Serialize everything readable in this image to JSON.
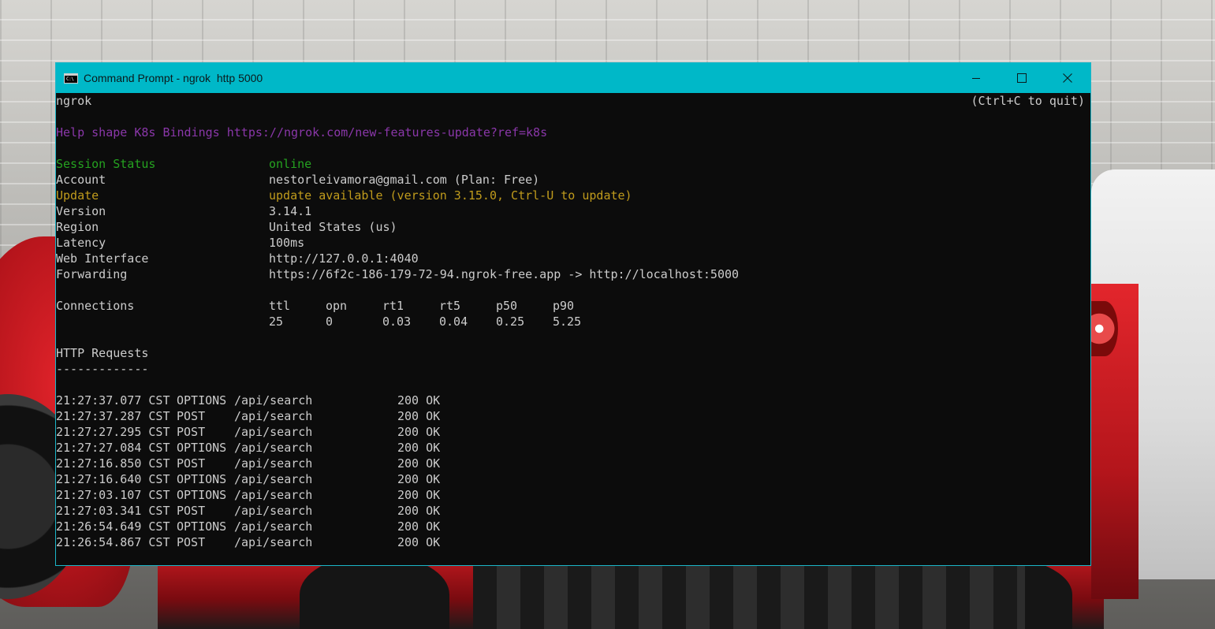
{
  "window": {
    "title": "Command Prompt - ngrok  http 5000"
  },
  "console": {
    "app_name": "ngrok",
    "quit_hint": "(Ctrl+C to quit)",
    "help_line": "Help shape K8s Bindings https://ngrok.com/new-features-update?ref=k8s",
    "status_rows": [
      {
        "label": "Session Status",
        "value": "online",
        "color": "green"
      },
      {
        "label": "Account",
        "value": "nestorleivamora@gmail.com (Plan: Free)",
        "color": "default"
      },
      {
        "label": "Update",
        "value": "update available (version 3.15.0, Ctrl-U to update)",
        "color": "yellow"
      },
      {
        "label": "Version",
        "value": "3.14.1",
        "color": "default"
      },
      {
        "label": "Region",
        "value": "United States (us)",
        "color": "default"
      },
      {
        "label": "Latency",
        "value": "100ms",
        "color": "default"
      },
      {
        "label": "Web Interface",
        "value": "http://127.0.0.1:4040",
        "color": "default"
      },
      {
        "label": "Forwarding",
        "value": "https://6f2c-186-179-72-94.ngrok-free.app -> http://localhost:5000",
        "color": "default"
      }
    ],
    "connections": {
      "label": "Connections",
      "headers": [
        "ttl",
        "opn",
        "rt1",
        "rt5",
        "p50",
        "p90"
      ],
      "values": [
        "25",
        "0",
        "0.03",
        "0.04",
        "0.25",
        "5.25"
      ]
    },
    "http_requests": {
      "title": "HTTP Requests",
      "underline": "-------------",
      "rows": [
        {
          "time": "21:27:37.077 CST",
          "method": "OPTIONS",
          "path": "/api/search",
          "status": "200 OK"
        },
        {
          "time": "21:27:37.287 CST",
          "method": "POST",
          "path": "/api/search",
          "status": "200 OK"
        },
        {
          "time": "21:27:27.295 CST",
          "method": "POST",
          "path": "/api/search",
          "status": "200 OK"
        },
        {
          "time": "21:27:27.084 CST",
          "method": "OPTIONS",
          "path": "/api/search",
          "status": "200 OK"
        },
        {
          "time": "21:27:16.850 CST",
          "method": "POST",
          "path": "/api/search",
          "status": "200 OK"
        },
        {
          "time": "21:27:16.640 CST",
          "method": "OPTIONS",
          "path": "/api/search",
          "status": "200 OK"
        },
        {
          "time": "21:27:03.107 CST",
          "method": "OPTIONS",
          "path": "/api/search",
          "status": "200 OK"
        },
        {
          "time": "21:27:03.341 CST",
          "method": "POST",
          "path": "/api/search",
          "status": "200 OK"
        },
        {
          "time": "21:26:54.649 CST",
          "method": "OPTIONS",
          "path": "/api/search",
          "status": "200 OK"
        },
        {
          "time": "21:26:54.867 CST",
          "method": "POST",
          "path": "/api/search",
          "status": "200 OK"
        }
      ]
    }
  },
  "colors": {
    "titlebar": "#00b8c8",
    "console_bg": "#0c0c0c",
    "text": "#cccccc",
    "purple": "#8a37a9",
    "green": "#25a220",
    "yellow": "#c09b1c"
  },
  "icons": {
    "app": "cmd-icon",
    "minimize": "minimize-icon",
    "maximize": "maximize-icon",
    "close": "close-icon"
  }
}
